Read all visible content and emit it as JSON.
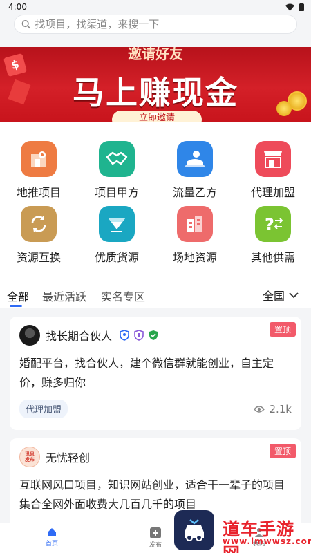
{
  "status_bar": {
    "time": "4:00"
  },
  "search": {
    "placeholder": "找项目，找渠道，来搜一下"
  },
  "banner": {
    "sub_title": "邀请好友",
    "main_title": "马上赚现金",
    "tag": "立即邀请"
  },
  "categories": [
    {
      "label": "地推项目",
      "icon": "map-pin-icon",
      "color": "#ee7b42"
    },
    {
      "label": "项目甲方",
      "icon": "handshake-icon",
      "color": "#1fb48f"
    },
    {
      "label": "流量乙方",
      "icon": "flow-user-icon",
      "color": "#2f86e8"
    },
    {
      "label": "代理加盟",
      "icon": "shop-icon",
      "color": "#ee4b5a"
    },
    {
      "label": "资源互换",
      "icon": "exchange-icon",
      "color": "#c99b54"
    },
    {
      "label": "优质货源",
      "icon": "diamond-cart-icon",
      "color": "#1aa7c2"
    },
    {
      "label": "场地资源",
      "icon": "building-icon",
      "color": "#ee6b6b"
    },
    {
      "label": "其他供需",
      "icon": "question-swap-icon",
      "color": "#7bc432"
    }
  ],
  "tabs": [
    {
      "label": "全部",
      "active": true
    },
    {
      "label": "最近活跃",
      "active": false
    },
    {
      "label": "实名专区",
      "active": false
    }
  ],
  "region": {
    "label": "全国"
  },
  "posts": [
    {
      "author": "找长期合伙人",
      "pinned_label": "置顶",
      "content": "婚配平台，找合伙人，建个微信群就能创业，自主定价，赚多归你",
      "tag": "代理加盟",
      "views": "2.1k"
    },
    {
      "author": "无忧轻创",
      "avatar_text": "讯息发布",
      "pinned_label": "置顶",
      "content": "互联网风口项目，知识网站创业，适合干一辈子的项目集合全网外面收费大几百几千的项目"
    }
  ],
  "bottom_nav": [
    {
      "label": "首页",
      "active": true
    },
    {
      "label": "发布",
      "active": false
    },
    {
      "label": "我的",
      "active": false
    }
  ],
  "watermark": {
    "name": "道车手游网",
    "url": "www.lmwwsz.com"
  }
}
